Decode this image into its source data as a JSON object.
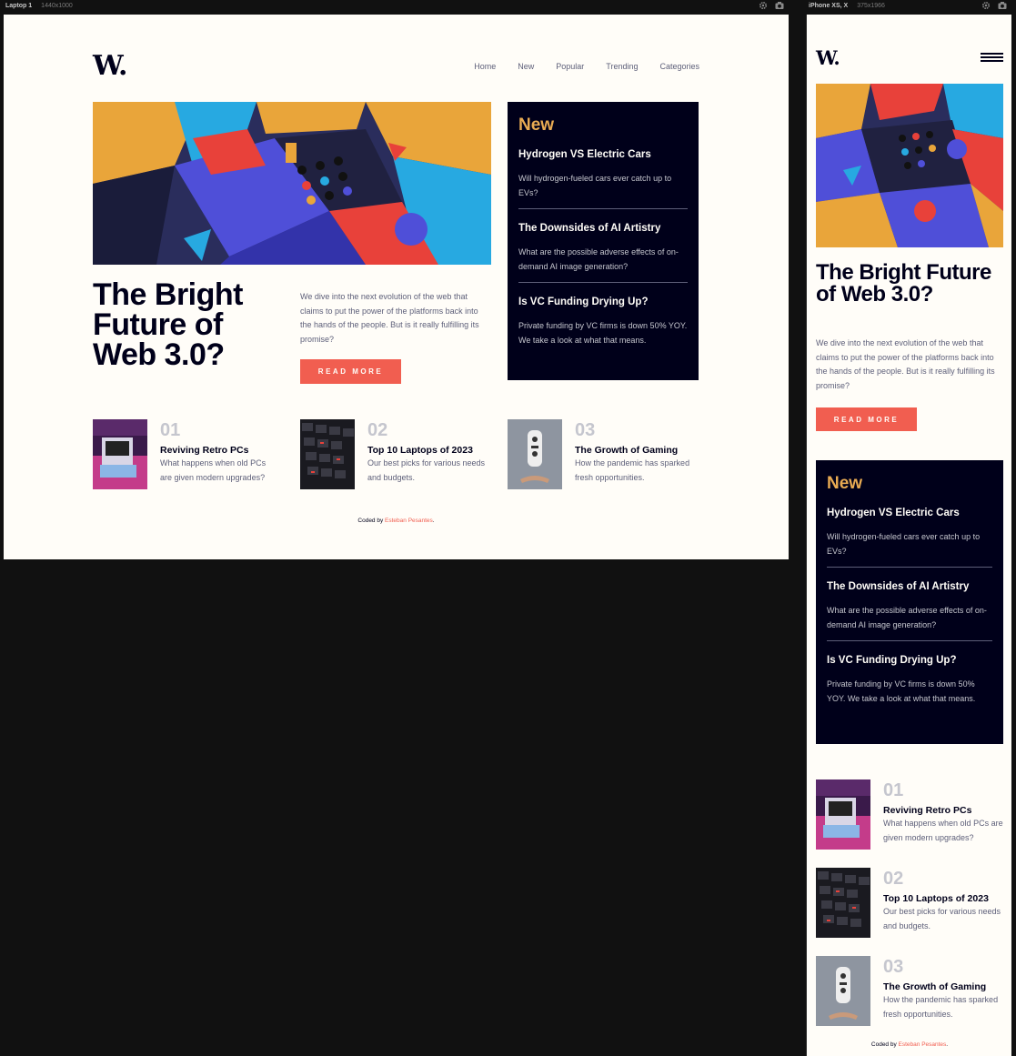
{
  "laptop_bar": {
    "device": "Laptop 1",
    "size": "1440x1000"
  },
  "phone_bar": {
    "device": "iPhone XS, X",
    "size": "375x1966"
  },
  "site": {
    "logo": "W.",
    "nav": [
      "Home",
      "New",
      "Popular",
      "Trending",
      "Categories"
    ],
    "hero": {
      "title": "The Bright Future of Web 3.0?",
      "description": "We dive into the next evolution of the web that claims to put the power of the platforms back into the hands of the people. But is it really fulfilling its promise?",
      "button_label": "READ MORE"
    },
    "new_section": {
      "heading": "New",
      "items": [
        {
          "title": "Hydrogen VS Electric Cars",
          "description": "Will hydrogen-fueled cars ever catch up to EVs?"
        },
        {
          "title": "The Downsides of AI Artistry",
          "description": "What are the possible adverse effects of on-demand AI image generation?"
        },
        {
          "title": "Is VC Funding Drying Up?",
          "description": "Private funding by VC firms is down 50% YOY. We take a look at what that means."
        }
      ]
    },
    "cards": [
      {
        "number": "01",
        "title": "Reviving Retro PCs",
        "description": "What happens when old PCs are given modern upgrades?"
      },
      {
        "number": "02",
        "title": "Top 10 Laptops of 2023",
        "description": "Our best picks for various needs and budgets."
      },
      {
        "number": "03",
        "title": "The Growth of Gaming",
        "description": "How the pandemic has sparked fresh opportunities."
      }
    ],
    "footer": {
      "prefix": "Coded by",
      "author": "Esteban Pesantes",
      "suffix": "."
    }
  },
  "colors": {
    "accent_red": "#f15e50",
    "accent_gold": "#e9ab53",
    "dark_navy": "#00001a",
    "off_white": "#fffdf8",
    "grayish_blue": "#5d5f79",
    "light_gray": "#c5c6ce"
  },
  "icons": {
    "toolbar": [
      "settings-icon",
      "screenshot-icon"
    ],
    "menu": "hamburger-menu-icon"
  }
}
